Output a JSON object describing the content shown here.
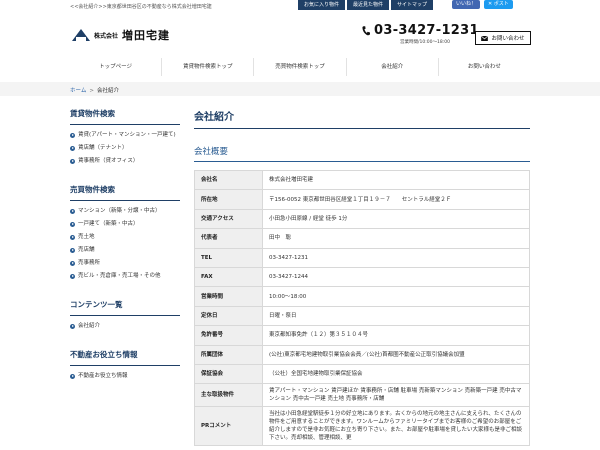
{
  "tagline": "<<会社紹介>>東京都世田谷区の不動産なら株式会社増田宅建",
  "top_links": [
    "お気に入り物件",
    "最近見た物件",
    "サイトマップ"
  ],
  "social": {
    "facebook": "いいね！",
    "twitter": "ポスト"
  },
  "logo": {
    "corp": "株式会社",
    "name": "増田宅建"
  },
  "phone": {
    "number": "03-3427-1231",
    "hours": "営業時間/10:00～18:00"
  },
  "contact_label": "お問い合わせ",
  "nav": [
    "トップページ",
    "賃貸物件検索トップ",
    "売買物件検索トップ",
    "会社紹介",
    "お問い合わせ"
  ],
  "breadcrumb": {
    "home": "ホーム",
    "sep": ">",
    "current": "会社紹介"
  },
  "sidebar": {
    "rent": {
      "title": "賃貸物件検索",
      "items": [
        "賃貸(アパート・マンション・一戸建て)",
        "賃店舗（テナント）",
        "賃事務所（貸オフィス）"
      ]
    },
    "sale": {
      "title": "売買物件検索",
      "items": [
        "マンション（新築・分譲・中古）",
        "一戸建て（新築・中古）",
        "売土地",
        "売店舗",
        "売事務所",
        "売ビル・売倉庫・売工場・その他"
      ]
    },
    "content": {
      "title": "コンテンツ一覧",
      "items": [
        "会社紹介"
      ]
    },
    "tips": {
      "title": "不動産お役立ち情報",
      "items": [
        "不動産お役立ち情報"
      ]
    }
  },
  "main": {
    "title": "会社紹介",
    "subtitle": "会社概要",
    "rows": [
      {
        "key": "会社名",
        "value": "株式会社増田宅建"
      },
      {
        "key": "所在地",
        "value": "〒156-0052 東京都世田谷区経堂１丁目１９－７　　セントラル経堂２Ｆ"
      },
      {
        "key": "交通アクセス",
        "value": "小田急小田原線 / 経堂 徒歩 1分"
      },
      {
        "key": "代表者",
        "value": "田中　聡"
      },
      {
        "key": "TEL",
        "value": "03-3427-1231"
      },
      {
        "key": "FAX",
        "value": "03-3427-1244"
      },
      {
        "key": "営業時間",
        "value": "10:00～18:00"
      },
      {
        "key": "定休日",
        "value": "日曜・祭日"
      },
      {
        "key": "免許番号",
        "value": "東京都知事免許（１２）第３５１０４号"
      },
      {
        "key": "所属団体",
        "value": "(公社)東京都宅地建物取引業協会会員／(公社)首都圏不動産公正取引協議会加盟"
      },
      {
        "key": "保証協会",
        "value": "（公社）全国宅地建物取引業保証協会"
      },
      {
        "key": "主な取扱物件",
        "value": "賃アパート・マンション 賃戸建ほか 賃事務所・店舗 駐車場 売新築マンション 売新築一戸建 売中古マンション 売中古一戸建 売土地 売事務所・店舗"
      },
      {
        "key": "PRコメント",
        "value": "当社は小田急経堂駅徒歩１分の好立地にあります。古くからの地元の地主さんに支えられ、たくさんの物件をご用意することができます。ワンルームからファミリータイプまでお客様のご希望のお部屋をご紹介しますので是非お気軽にお立ち寄り下さい。また、お部屋や駐車場を貸したい大家様も是非ご相談下さい。売却相談、管理相談、更"
      }
    ]
  }
}
